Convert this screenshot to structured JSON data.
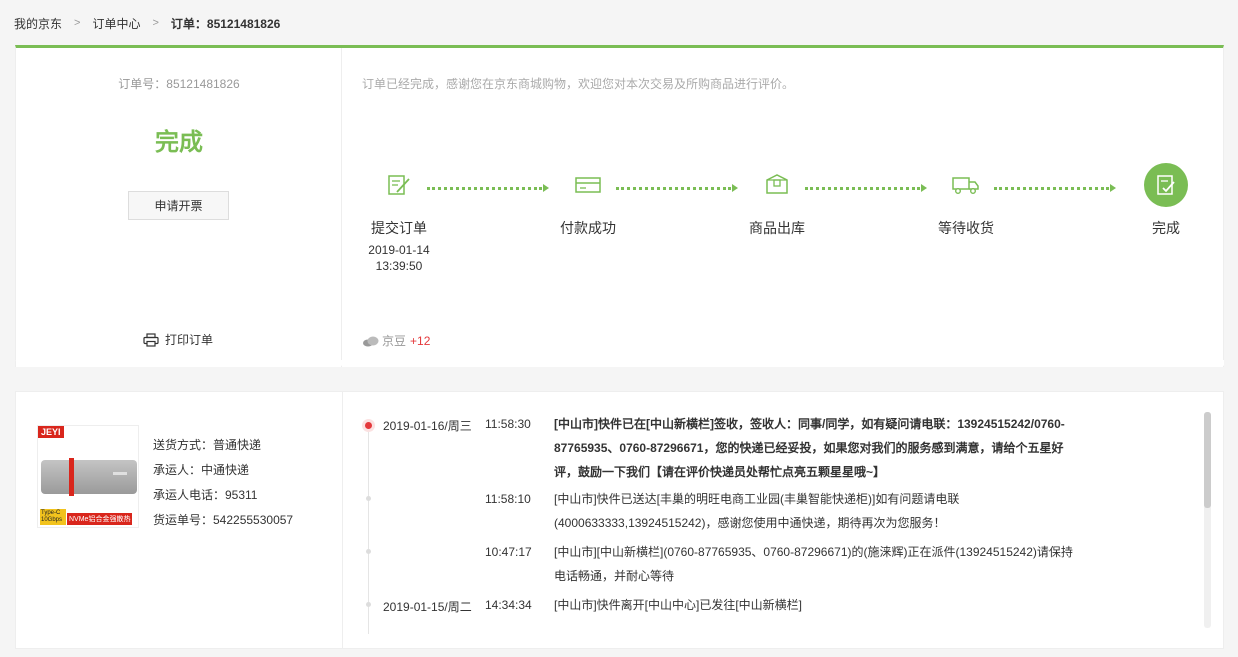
{
  "breadcrumb": {
    "items": [
      "我的京东",
      "订单中心"
    ],
    "current": "订单：85121481826"
  },
  "order": {
    "number_label": "订单号：85121481826",
    "status": "完成",
    "invoice_button": "申请开票",
    "print_label": "打印订单",
    "notice": "订单已经完成，感谢您在京东商城购物，欢迎您对本次交易及所购商品进行评价。",
    "beans_label": "京豆",
    "beans_value": "+12"
  },
  "progress": {
    "steps": [
      {
        "label": "提交订单",
        "date": "2019-01-14",
        "time": "13:39:50",
        "icon": "edit-icon"
      },
      {
        "label": "付款成功",
        "date": "",
        "time": "",
        "icon": "card-icon"
      },
      {
        "label": "商品出库",
        "date": "",
        "time": "",
        "icon": "box-icon"
      },
      {
        "label": "等待收货",
        "date": "",
        "time": "",
        "icon": "truck-icon"
      },
      {
        "label": "完成",
        "date": "",
        "time": "",
        "icon": "check-doc-icon"
      }
    ]
  },
  "product": {
    "brand": "JEYI",
    "tag1": "Type-C 10Gbps",
    "tag2": "NVMe铝合金强散热"
  },
  "shipping": {
    "method": "送货方式：普通快递",
    "carrier": "承运人：中通快递",
    "phone": "承运人电话：95311",
    "tracking": "货运单号：542255530057"
  },
  "timeline": [
    {
      "date": "2019-01-16/周三",
      "time": "11:58:30",
      "text": "[中山市]快件已在[中山新横栏]签收，签收人：同事/同学，如有疑问请电联：13924515242/0760-87765935、0760-87296671，您的快递已经妥投，如果您对我们的服务感到满意，请给个五星好评，鼓励一下我们【请在评价快递员处帮忙点亮五颗星星哦~】"
    },
    {
      "date": "",
      "time": "11:58:10",
      "text": "[中山市]快件已送达[丰巢的明旺电商工业园(丰巢智能快递柜)]如有问题请电联(4000633333,13924515242)，感谢您使用中通快递，期待再次为您服务！"
    },
    {
      "date": "",
      "time": "10:47:17",
      "text": "[中山市][中山新横栏](0760-87765935、0760-87296671)的(施涞辉)正在派件(13924515242)请保持电话畅通，并耐心等待"
    },
    {
      "date": "2019-01-15/周二",
      "time": "14:34:34",
      "text": "[中山市]快件离开[中山中心]已发往[中山新横栏]"
    }
  ],
  "colors": {
    "accent": "#7abd54",
    "red": "#e4393c"
  }
}
